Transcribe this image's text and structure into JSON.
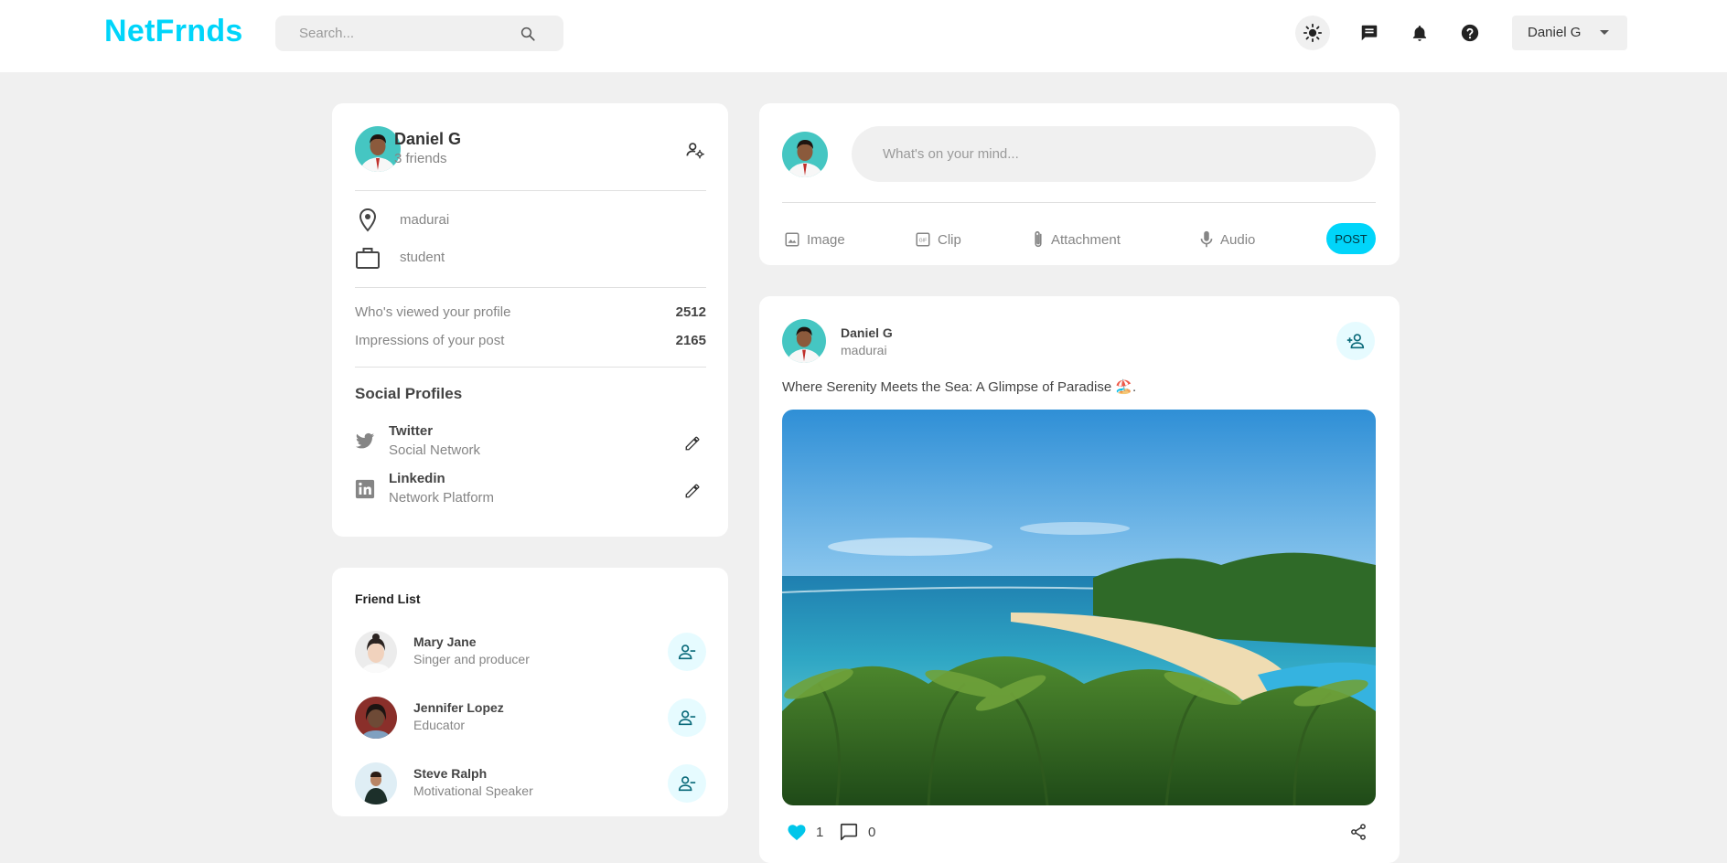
{
  "app": {
    "logo": "NetFrnds",
    "brand_color": "#00d5fa"
  },
  "search": {
    "placeholder": "Search..."
  },
  "header": {
    "icons": [
      "light-mode-icon",
      "message-icon",
      "notifications-icon",
      "help-icon"
    ],
    "user_select_value": "Daniel G"
  },
  "profile": {
    "name": "Daniel G",
    "friends": "3 friends",
    "location": "madurai",
    "occupation": "student",
    "stats": [
      {
        "label": "Who's viewed your profile",
        "value": "2512"
      },
      {
        "label": "Impressions of your post",
        "value": "2165"
      }
    ],
    "social_title": "Social Profiles",
    "socials": [
      {
        "name": "Twitter",
        "subtitle": "Social Network"
      },
      {
        "name": "Linkedin",
        "subtitle": "Network Platform"
      }
    ]
  },
  "friend_list": {
    "title": "Friend List",
    "friends": [
      {
        "name": "Mary Jane",
        "role": "Singer and producer"
      },
      {
        "name": "Jennifer Lopez",
        "role": "Educator"
      },
      {
        "name": "Steve Ralph",
        "role": "Motivational Speaker"
      }
    ]
  },
  "composer": {
    "placeholder": "What's on your mind...",
    "tools": [
      "Image",
      "Clip",
      "Attachment",
      "Audio"
    ],
    "post_label": "POST"
  },
  "post": {
    "author": "Daniel G",
    "location": "madurai",
    "text": "Where Serenity Meets the Sea: A Glimpse of Paradise 🏖️.",
    "likes": "1",
    "comments": "0"
  }
}
